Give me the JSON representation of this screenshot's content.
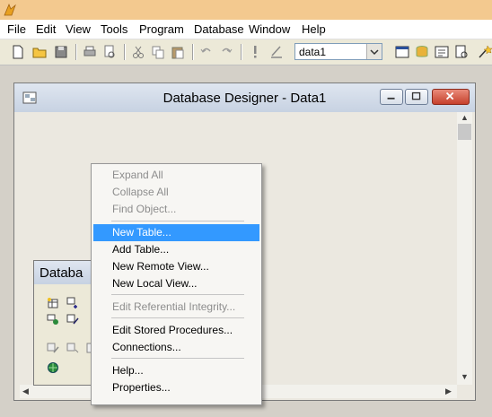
{
  "menubar": [
    "File",
    "Edit",
    "View",
    "Tools",
    "Program",
    "Database",
    "Window",
    "Help"
  ],
  "toolbar": {
    "database_combo": "data1",
    "icons": [
      "new-file-icon",
      "open-folder-icon",
      "save-icon",
      "print-icon",
      "print-preview-icon",
      "cut-icon",
      "copy-icon",
      "paste-icon",
      "undo-icon",
      "redo-icon",
      "run-icon",
      "modify-icon"
    ],
    "right_icons": [
      "command-window-icon",
      "data-session-icon",
      "properties-window-icon",
      "code-window-icon",
      "wizard-icon"
    ]
  },
  "designer": {
    "title": "Database Designer - Data1"
  },
  "db_toolbar": {
    "title": "Databa"
  },
  "context_menu": {
    "items": [
      {
        "label": "Expand All",
        "enabled": false
      },
      {
        "label": "Collapse All",
        "enabled": false
      },
      {
        "label": "Find Object...",
        "enabled": false
      },
      {
        "label": "New Table...",
        "enabled": true,
        "highlighted": true
      },
      {
        "label": "Add Table...",
        "enabled": true
      },
      {
        "label": "New Remote View...",
        "enabled": true
      },
      {
        "label": "New Local View...",
        "enabled": true
      },
      {
        "label": "Edit Referential Integrity...",
        "enabled": false
      },
      {
        "label": "Edit Stored Procedures...",
        "enabled": true
      },
      {
        "label": "Connections...",
        "enabled": true
      },
      {
        "label": "Help...",
        "enabled": true
      },
      {
        "label": "Properties...",
        "enabled": true
      }
    ]
  },
  "colors": {
    "highlight": "#3399ff",
    "disabled_text": "#8d8d8d",
    "title_strip": "#f3c98f"
  }
}
